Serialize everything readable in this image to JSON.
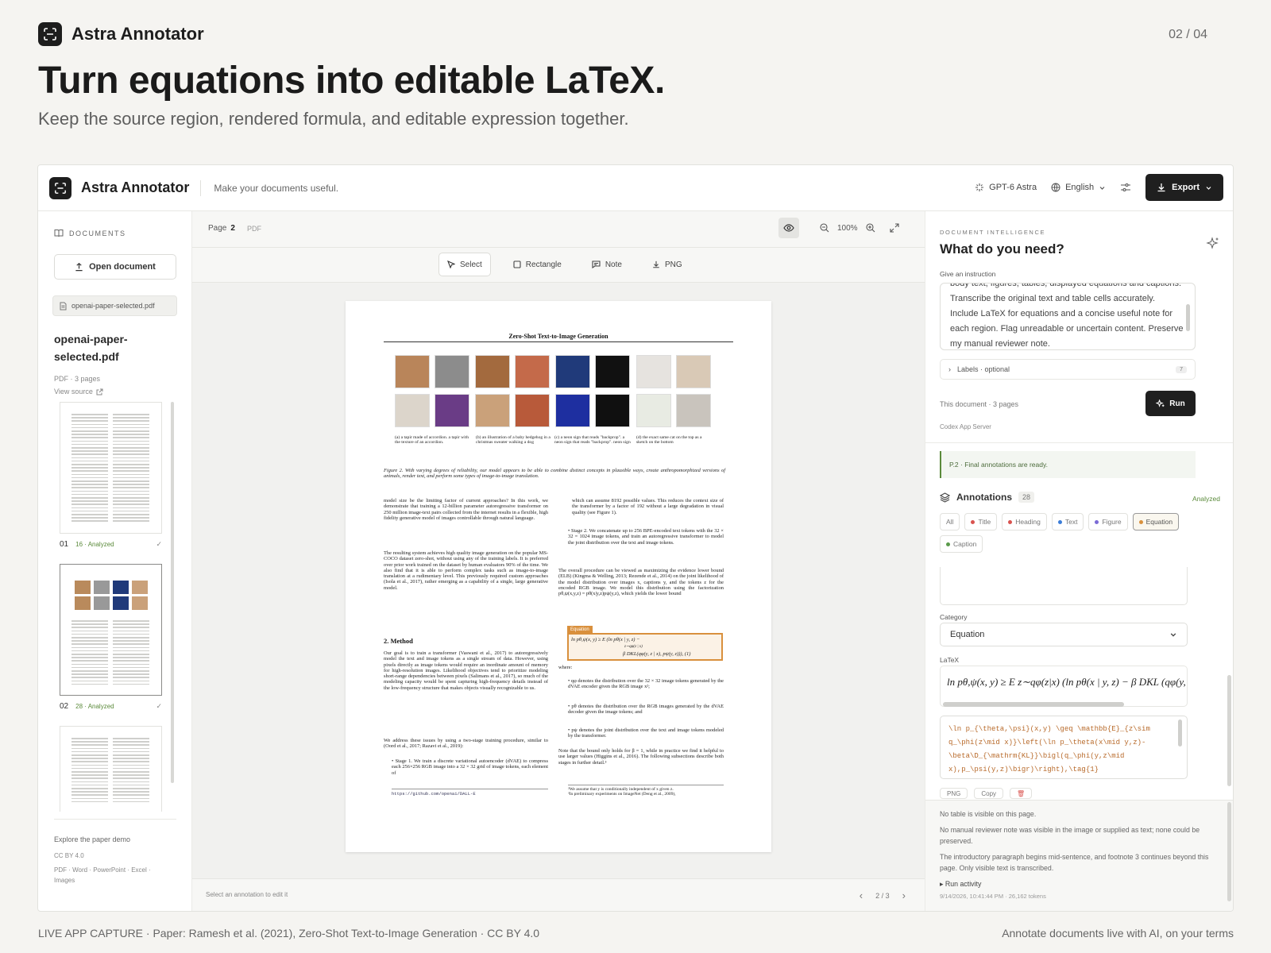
{
  "slide": {
    "brand": "Astra Annotator",
    "pager": "02 / 04",
    "headline": "Turn equations into editable LaTeX.",
    "subline": "Keep the source region, rendered formula, and editable expression together.",
    "footer_left": "LIVE APP CAPTURE · Paper: Ramesh et al. (2021), Zero-Shot Text-to-Image Generation · CC BY 4.0",
    "footer_right": "Annotate documents live with AI, on your terms"
  },
  "topbar": {
    "app_name": "Astra Annotator",
    "tagline": "Make your documents useful.",
    "model": "GPT-6 Astra",
    "language": "English",
    "export_label": "Export"
  },
  "sidebar": {
    "section_title": "DOCUMENTS",
    "open_label": "Open document",
    "file_chip": "openai-paper-selected.pdf",
    "doc_title": "openai-paper-selected.pdf",
    "doc_meta": "PDF · 3 pages",
    "view_source": "View source",
    "thumbs": [
      {
        "num": "01",
        "status": "16 · Analyzed"
      },
      {
        "num": "02",
        "status": "28 · Analyzed"
      },
      {
        "num": "03",
        "status": ""
      }
    ],
    "footer": {
      "explore": "Explore the paper demo",
      "license": "CC BY 4.0",
      "formats": "PDF · Word · PowerPoint · Excel ·",
      "formats2": "Images"
    }
  },
  "viewer": {
    "page_label": "Page",
    "page_num": "2",
    "format": "PDF",
    "zoom": "100%",
    "tools": {
      "select": "Select",
      "rectangle": "Rectangle",
      "note": "Note",
      "png": "PNG"
    },
    "status_left": "Select an annotation to edit it",
    "page_count": "2 / 3"
  },
  "paper": {
    "title": "Zero-Shot Text-to-Image Generation",
    "captions": {
      "a": "(a) a tapir made of accordion. a tapir with the texture of an accordion.",
      "b": "(b) an illustration of a baby hedgehog in a christmas sweater walking a dog",
      "c": "(c) a neon sign that reads \"backprop\". a neon sign that reads \"backprop\". neon sign",
      "d": "(d) the exact same cat on the top as a sketch on the bottom"
    },
    "figure_caption": "Figure 2. With varying degrees of reliability, our model appears to be able to combine distinct concepts in plausible ways, create anthropomorphized versions of animals, render text, and perform some types of image-to-image translation.",
    "left_col_1": "model size be the limiting factor of current approaches? In this work, we demonstrate that training a 12-billion parameter autoregressive transformer on 250 million image-text pairs collected from the internet results in a flexible, high fidelity generative model of images controllable through natural language.",
    "left_col_2": "The resulting system achieves high quality image generation on the popular MS-COCO dataset zero-shot, without using any of the training labels. It is preferred over prior work trained on the dataset by human evaluators 90% of the time. We also find that it is able to perform complex tasks such as image-to-image translation at a rudimentary level. This previously required custom approaches (Isola et al., 2017), rather emerging as a capability of a single, large generative model.",
    "section_heading": "2. Method",
    "left_col_3": "Our goal is to train a transformer (Vaswani et al., 2017) to autoregressively model the text and image tokens as a single stream of data. However, using pixels directly as image tokens would require an inordinate amount of memory for high-resolution images. Likelihood objectives tend to prioritize modeling short-range dependencies between pixels (Salimans et al., 2017), so much of the modeling capacity would be spent capturing high-frequency details instead of the low-frequency structure that makes objects visually recognizable to us.",
    "left_col_4": "We address these issues by using a two-stage training procedure, similar to (Oord et al., 2017; Razavi et al., 2019):",
    "left_col_5": "• Stage 1. We train a discrete variational autoencoder (dVAE) to compress each 256×256 RGB image into a 32 × 32 grid of image tokens, each element of",
    "left_footnote": "https://github.com/openai/DALL-E",
    "right_col_1": "which can assume 8192 possible values. This reduces the context size of the transformer by a factor of 192 without a large degradation in visual quality (see Figure 1).",
    "right_col_2": "• Stage 2. We concatenate up to 256 BPE-encoded text tokens with the 32 × 32 = 1024 image tokens, and train an autoregressive transformer to model the joint distribution over the text and image tokens.",
    "right_col_3": "The overall procedure can be viewed as maximizing the evidence lower bound (ELB) (Kingma & Welling, 2013; Rezende et al., 2014) on the joint likelihood of the model distribution over images x, captions y, and the tokens z for the encoded RGB image. We model this distribution using the factorization pθ,ψ(x,y,z) = pθ(x|y,z)pψ(y,z), which yields the lower bound",
    "eq_tag": "Equation",
    "eq_line1": "ln pθ,ψ(x, y) ≥ E (ln pθ(x | y, z) −",
    "eq_line1b": "z∼qφ(z | x)",
    "eq_line2": "β DKL(qφ(y, z | x), pψ(y, z))),   (1)",
    "right_col_4": "where:",
    "right_col_5": "• qφ denotes the distribution over the 32 × 32 image tokens generated by the dVAE encoder given the RGB image x²;",
    "right_col_6": "• pθ denotes the distribution over the RGB images generated by the dVAE decoder given the image tokens; and",
    "right_col_7": "• pψ denotes the joint distribution over the text and image tokens modeled by the transformer.",
    "right_col_8": "Note that the bound only holds for β = 1, while in practice we find it helpful to use larger values (Higgins et al., 2016). The following subsections describe both stages in further detail.³",
    "right_footnote_1": "²We assume that y is conditionally independent of x given z.",
    "right_footnote_2": "³In preliminary experiments on ImageNet (Deng et al., 2009),"
  },
  "panel": {
    "kicker": "DOCUMENT INTELLIGENCE",
    "title": "What do you need?",
    "instr_label": "Give an instruction",
    "instruction": "body text, figures, tables, displayed equations and captions. Transcribe the original text and table cells accurately. Include LaTeX for equations and a concise useful note for each region. Flag unreadable or uncertain content. Preserve my manual reviewer note.",
    "labels_label": "Labels · optional",
    "labels_count": "7",
    "this_doc": "This document · 3 pages",
    "run_label": "Run",
    "server": "Codex App Server",
    "ready": "P.2 · Final annotations are ready.",
    "ann_title": "Annotations",
    "ann_count": "28",
    "analyzed": "Analyzed",
    "chips": [
      {
        "label": "All",
        "color": ""
      },
      {
        "label": "Title",
        "color": "#d9534f"
      },
      {
        "label": "Heading",
        "color": "#d9534f"
      },
      {
        "label": "Text",
        "color": "#3b7dd8"
      },
      {
        "label": "Figure",
        "color": "#7b6bd6"
      },
      {
        "label": "Equation",
        "color": "#d9903d"
      },
      {
        "label": "Caption",
        "color": "#5a9a4a"
      }
    ],
    "category_label": "Category",
    "category_value": "Equation",
    "latex_label": "LaTeX",
    "latex_rendered": "ln pθ,ψ(x, y) ≥ E z∼qφ(z|x) (ln pθ(x | y, z) − β DKL (qφ(y,",
    "latex_source": "\\ln p_{\\theta,\\psi}(x,y) \\geq \\mathbb{E}_{z\\sim q_\\phi(z\\mid x)}\\left(\\ln p_\\theta(x\\mid y,z)- \\beta\\D_{\\mathrm{KL}}\\bigl(q_\\phi(y,z\\mid x),p_\\psi(y,z)\\bigr)\\right),\\tag{1}",
    "btn_png": "PNG",
    "btn_copy": "Copy",
    "notes": [
      "No table is visible on this page.",
      "No manual reviewer note was visible in the image or supplied as text; none could be preserved.",
      "The introductory paragraph begins mid-sentence, and footnote 3 continues beyond this page. Only visible text is transcribed."
    ],
    "run_activity": "Run activity",
    "timestamp": "9/14/2026, 10:41:44 PM · 26,162 tokens"
  }
}
